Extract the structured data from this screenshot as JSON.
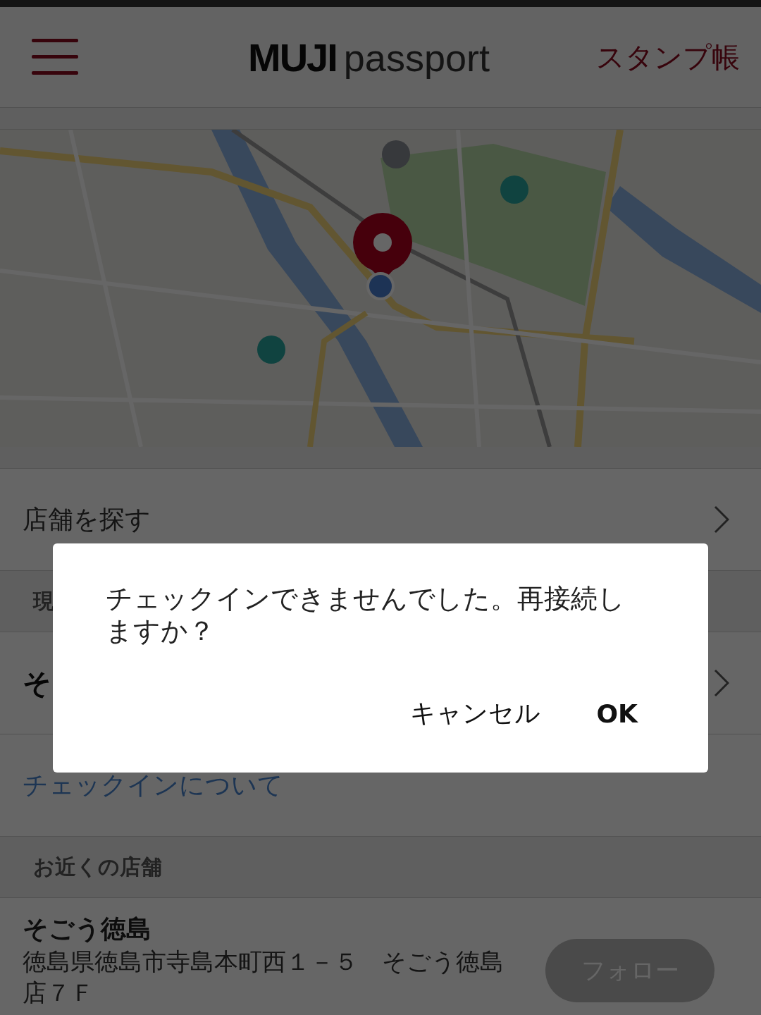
{
  "header": {
    "logo_bold": "MUJI",
    "logo_light": "passport",
    "stamp_link": "スタンプ帳"
  },
  "find_store": {
    "label": "店舗を探す"
  },
  "current_section": {
    "title": "現"
  },
  "current_store": {
    "name": "そ"
  },
  "checkin_link": "チェックインについて",
  "nearby_section": {
    "title": "お近くの店舗"
  },
  "nearby_stores": [
    {
      "name": "そごう徳島",
      "address": "徳島県徳島市寺島本町西１－５　そごう徳島店７Ｆ",
      "follow": "フォロー"
    }
  ],
  "dialog": {
    "message": "チェックインできませんでした。再接続しますか？",
    "buttons": [
      {
        "label": "キャンセル",
        "kind": "cancel"
      },
      {
        "label": "OK",
        "kind": "ok"
      }
    ]
  }
}
